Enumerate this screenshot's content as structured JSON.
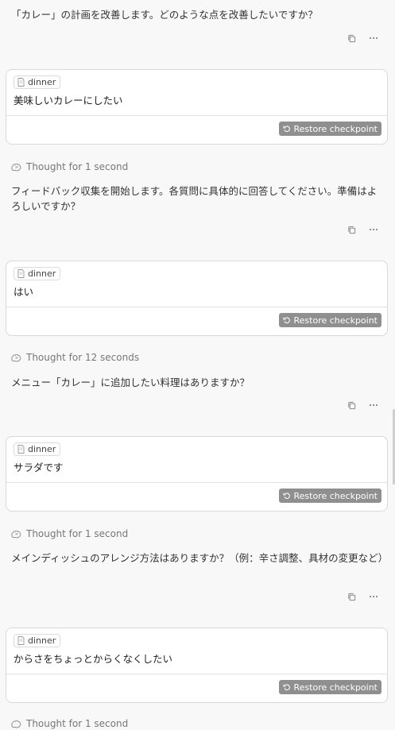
{
  "messages": {
    "m0": "「カレー」の計画を改善します。どのような点を改善したいですか？",
    "m1": "フィードバック収集を開始します。各質問に具体的に回答してください。準備はよろしいですか？",
    "m2": "メニュー「カレー」に追加したい料理はありますか？",
    "m3": "メインディッシュのアレンジ方法はありますか？（例：辛さ調整、具材の変更など）"
  },
  "thoughts": {
    "t1": "Thought for 1 second",
    "t2": "Thought for 12 seconds",
    "t3": "Thought for 1 second",
    "t4": "Thought for 1 second"
  },
  "user_messages": [
    {
      "file": "dinner",
      "text": "美味しいカレーにしたい"
    },
    {
      "file": "dinner",
      "text": "はい"
    },
    {
      "file": "dinner",
      "text": "サラダです"
    },
    {
      "file": "dinner",
      "text": "からさをちょっとからくなくしたい"
    }
  ],
  "restore_label": "Restore checkpoint",
  "icons": {
    "copy": "copy-icon",
    "more": "more-icon",
    "file": "file-icon",
    "thought": "brain-icon",
    "restore": "restore-icon"
  },
  "colors": {
    "background": "#f8f8f8",
    "card_border": "#d9d9d9",
    "restore_bg": "#8f8f8f",
    "muted_text": "#777777"
  }
}
